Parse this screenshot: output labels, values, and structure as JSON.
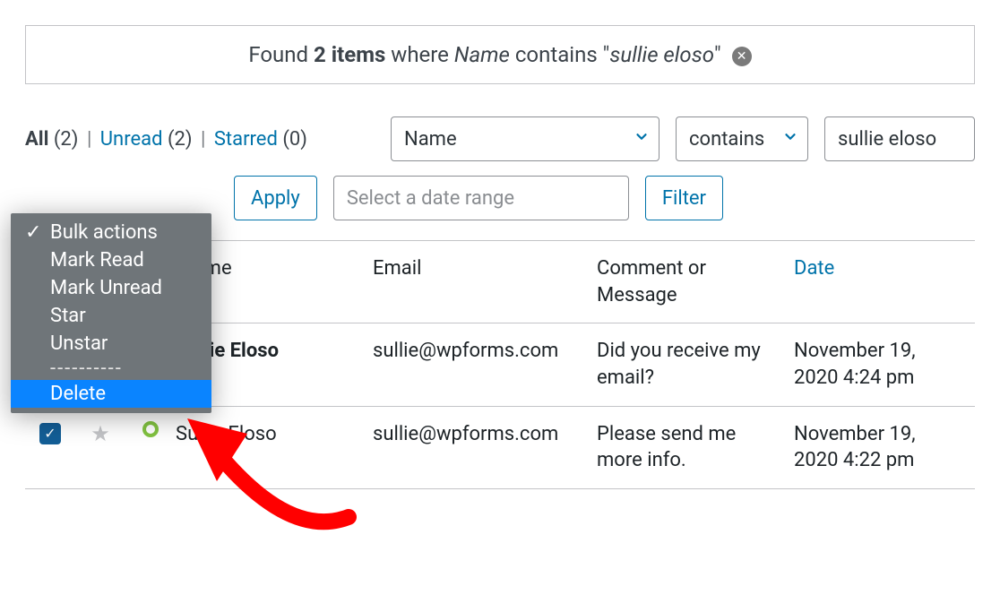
{
  "banner": {
    "prefix": "Found ",
    "count": "2 items",
    "mid": " where ",
    "field": "Name",
    "mid2": " contains \"",
    "query": "sullie eloso",
    "suffix": "\""
  },
  "views": {
    "all_label": "All",
    "all_count": "(2)",
    "unread_label": "Unread",
    "unread_count": "(2)",
    "starred_label": "Starred",
    "starred_count": "(0)"
  },
  "filters": {
    "field": "Name",
    "operator": "contains",
    "value": "sullie eloso"
  },
  "bulk": {
    "items": [
      "Bulk actions",
      "Mark Read",
      "Mark Unread",
      "Star",
      "Unstar"
    ],
    "separator": "----------",
    "delete": "Delete"
  },
  "buttons": {
    "apply": "Apply",
    "filter": "Filter"
  },
  "date_range_placeholder": "Select a date range",
  "table": {
    "headers": {
      "name": "Name",
      "email": "Email",
      "comment": "Comment or Message",
      "date": "Date"
    },
    "rows": [
      {
        "checked": false,
        "name": "Sullie Eloso",
        "email": "sullie@wpforms.com",
        "comment": "Did you receive my email?",
        "date": "November 19, 2020 4:24 pm"
      },
      {
        "checked": true,
        "name": "Sullie Eloso",
        "email": "sullie@wpforms.com",
        "comment": "Please send me more info.",
        "date": "November 19, 2020 4:22 pm"
      }
    ]
  }
}
